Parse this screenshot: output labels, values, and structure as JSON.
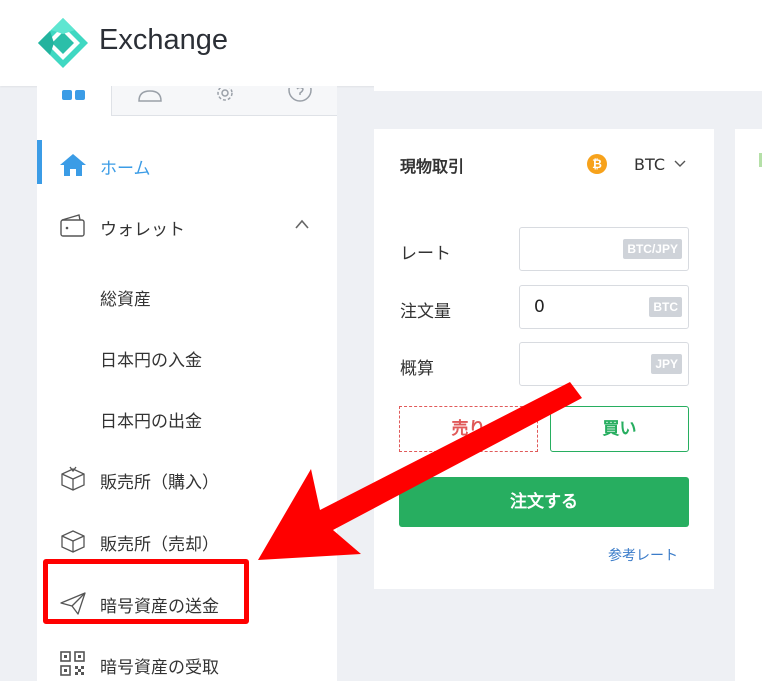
{
  "header": {
    "brand": "Exchange"
  },
  "sidebar": {
    "tabs": [
      "dashboard-icon",
      "user-icon",
      "gear-icon",
      "help-icon"
    ],
    "items": [
      {
        "label": "ホーム",
        "icon": "home-icon",
        "active": true
      },
      {
        "label": "ウォレット",
        "icon": "wallet-icon",
        "expanded": true
      },
      {
        "label": "総資産",
        "sub": true
      },
      {
        "label": "日本円の入金",
        "sub": true
      },
      {
        "label": "日本円の出金",
        "sub": true
      },
      {
        "label": "販売所（購入）",
        "icon": "box-in-icon"
      },
      {
        "label": "販売所（売却）",
        "icon": "box-out-icon"
      },
      {
        "label": "暗号資産の送金",
        "icon": "send-icon",
        "highlighted": true
      },
      {
        "label": "暗号資産の受取",
        "icon": "qr-code-icon"
      }
    ]
  },
  "trade": {
    "title": "現物取引",
    "coin_symbol": "₿",
    "coin": "BTC",
    "fields": [
      {
        "label": "レート",
        "value": "",
        "unit": "BTC/JPY"
      },
      {
        "label": "注文量",
        "value": "0",
        "unit": "BTC"
      },
      {
        "label": "概算",
        "value": "",
        "unit": "JPY"
      }
    ],
    "sell_label": "売り",
    "buy_label": "買い",
    "order_label": "注文する",
    "ref_rate_label": "参考レート"
  },
  "colors": {
    "active": "#3b9ce6",
    "buy": "#27ae60",
    "sell": "#e05a5a",
    "annotation": "#ff0000",
    "coin": "#f7a21b"
  }
}
